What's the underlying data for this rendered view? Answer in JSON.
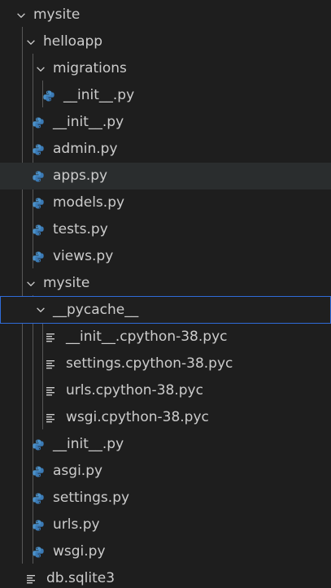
{
  "explorer": {
    "items": [
      {
        "label": "mysite",
        "type": "folder"
      },
      {
        "label": "helloapp",
        "type": "folder"
      },
      {
        "label": "migrations",
        "type": "folder"
      },
      {
        "label": "__init__.py",
        "type": "python"
      },
      {
        "label": "__init__.py",
        "type": "python"
      },
      {
        "label": "admin.py",
        "type": "python"
      },
      {
        "label": "apps.py",
        "type": "python"
      },
      {
        "label": "models.py",
        "type": "python"
      },
      {
        "label": "tests.py",
        "type": "python"
      },
      {
        "label": "views.py",
        "type": "python"
      },
      {
        "label": "mysite",
        "type": "folder"
      },
      {
        "label": "__pycache__",
        "type": "folder"
      },
      {
        "label": "__init__.cpython-38.pyc",
        "type": "text"
      },
      {
        "label": "settings.cpython-38.pyc",
        "type": "text"
      },
      {
        "label": "urls.cpython-38.pyc",
        "type": "text"
      },
      {
        "label": "wsgi.cpython-38.pyc",
        "type": "text"
      },
      {
        "label": "__init__.py",
        "type": "python"
      },
      {
        "label": "asgi.py",
        "type": "python"
      },
      {
        "label": "settings.py",
        "type": "python"
      },
      {
        "label": "urls.py",
        "type": "python"
      },
      {
        "label": "wsgi.py",
        "type": "python"
      },
      {
        "label": "db.sqlite3",
        "type": "text"
      }
    ]
  },
  "colors": {
    "background": "#1e1e1e",
    "text": "#cccccc",
    "python_icon": "#4a90c8",
    "hover_row": "#2a2d2e",
    "focus_border": "#2f6bd8"
  },
  "icons": {
    "folder": "chevron-down-icon",
    "python": "python-icon",
    "text": "text-lines-icon"
  }
}
